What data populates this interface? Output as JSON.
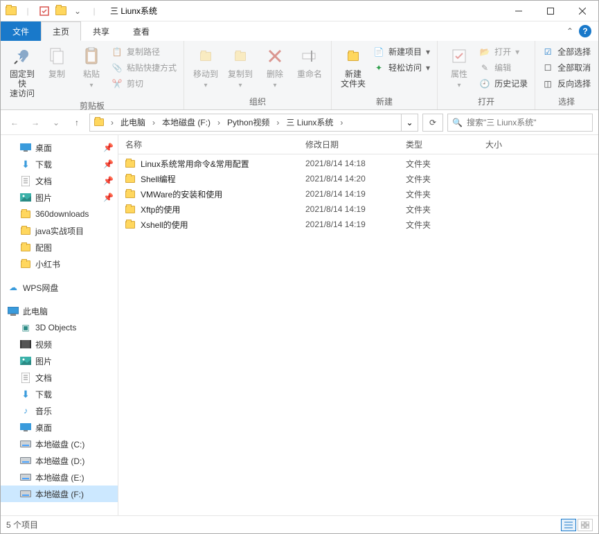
{
  "title": "三 Liunx系统",
  "tabs": {
    "file": "文件",
    "home": "主页",
    "share": "共享",
    "view": "查看"
  },
  "ribbon": {
    "pin": "固定到快\n速访问",
    "copy": "复制",
    "paste": "粘贴",
    "copy_path": "复制路径",
    "paste_shortcut": "粘贴快捷方式",
    "cut": "剪切",
    "clipboard": "剪贴板",
    "move_to": "移动到",
    "copy_to": "复制到",
    "delete": "删除",
    "rename": "重命名",
    "organize": "组织",
    "new_folder": "新建\n文件夹",
    "new_item": "新建项目",
    "easy_access": "轻松访问",
    "new": "新建",
    "properties": "属性",
    "open": "打开",
    "edit": "编辑",
    "history": "历史记录",
    "open_group": "打开",
    "select_all": "全部选择",
    "select_none": "全部取消",
    "invert": "反向选择",
    "select": "选择"
  },
  "breadcrumb": [
    "此电脑",
    "本地磁盘 (F:)",
    "Python视频",
    "三 Liunx系统"
  ],
  "search_placeholder": "搜索\"三 Liunx系统\"",
  "columns": {
    "name": "名称",
    "date": "修改日期",
    "type": "类型",
    "size": "大小"
  },
  "files": [
    {
      "name": "Linux系统常用命令&常用配置",
      "date": "2021/8/14 14:18",
      "type": "文件夹"
    },
    {
      "name": "Shell编程",
      "date": "2021/8/14 14:20",
      "type": "文件夹"
    },
    {
      "name": "VMWare的安装和使用",
      "date": "2021/8/14 14:19",
      "type": "文件夹"
    },
    {
      "name": "Xftp的使用",
      "date": "2021/8/14 14:19",
      "type": "文件夹"
    },
    {
      "name": "Xshell的使用",
      "date": "2021/8/14 14:19",
      "type": "文件夹"
    }
  ],
  "sidebar": {
    "quick": [
      {
        "label": "桌面",
        "icon": "desktop",
        "pin": true
      },
      {
        "label": "下载",
        "icon": "download",
        "pin": true
      },
      {
        "label": "文档",
        "icon": "doc",
        "pin": true
      },
      {
        "label": "图片",
        "icon": "picture",
        "pin": true
      },
      {
        "label": "360downloads",
        "icon": "folder"
      },
      {
        "label": "java实战项目",
        "icon": "folder"
      },
      {
        "label": "配图",
        "icon": "folder"
      },
      {
        "label": "小红书",
        "icon": "folder"
      }
    ],
    "wps": "WPS网盘",
    "this_pc": "此电脑",
    "pc": [
      {
        "label": "3D Objects",
        "icon": "cube"
      },
      {
        "label": "视频",
        "icon": "video"
      },
      {
        "label": "图片",
        "icon": "picture"
      },
      {
        "label": "文档",
        "icon": "doc"
      },
      {
        "label": "下载",
        "icon": "download"
      },
      {
        "label": "音乐",
        "icon": "music"
      },
      {
        "label": "桌面",
        "icon": "desktop"
      },
      {
        "label": "本地磁盘 (C:)",
        "icon": "drive"
      },
      {
        "label": "本地磁盘 (D:)",
        "icon": "drive"
      },
      {
        "label": "本地磁盘 (E:)",
        "icon": "drive"
      },
      {
        "label": "本地磁盘 (F:)",
        "icon": "drive",
        "selected": true
      }
    ]
  },
  "status": "5 个项目"
}
